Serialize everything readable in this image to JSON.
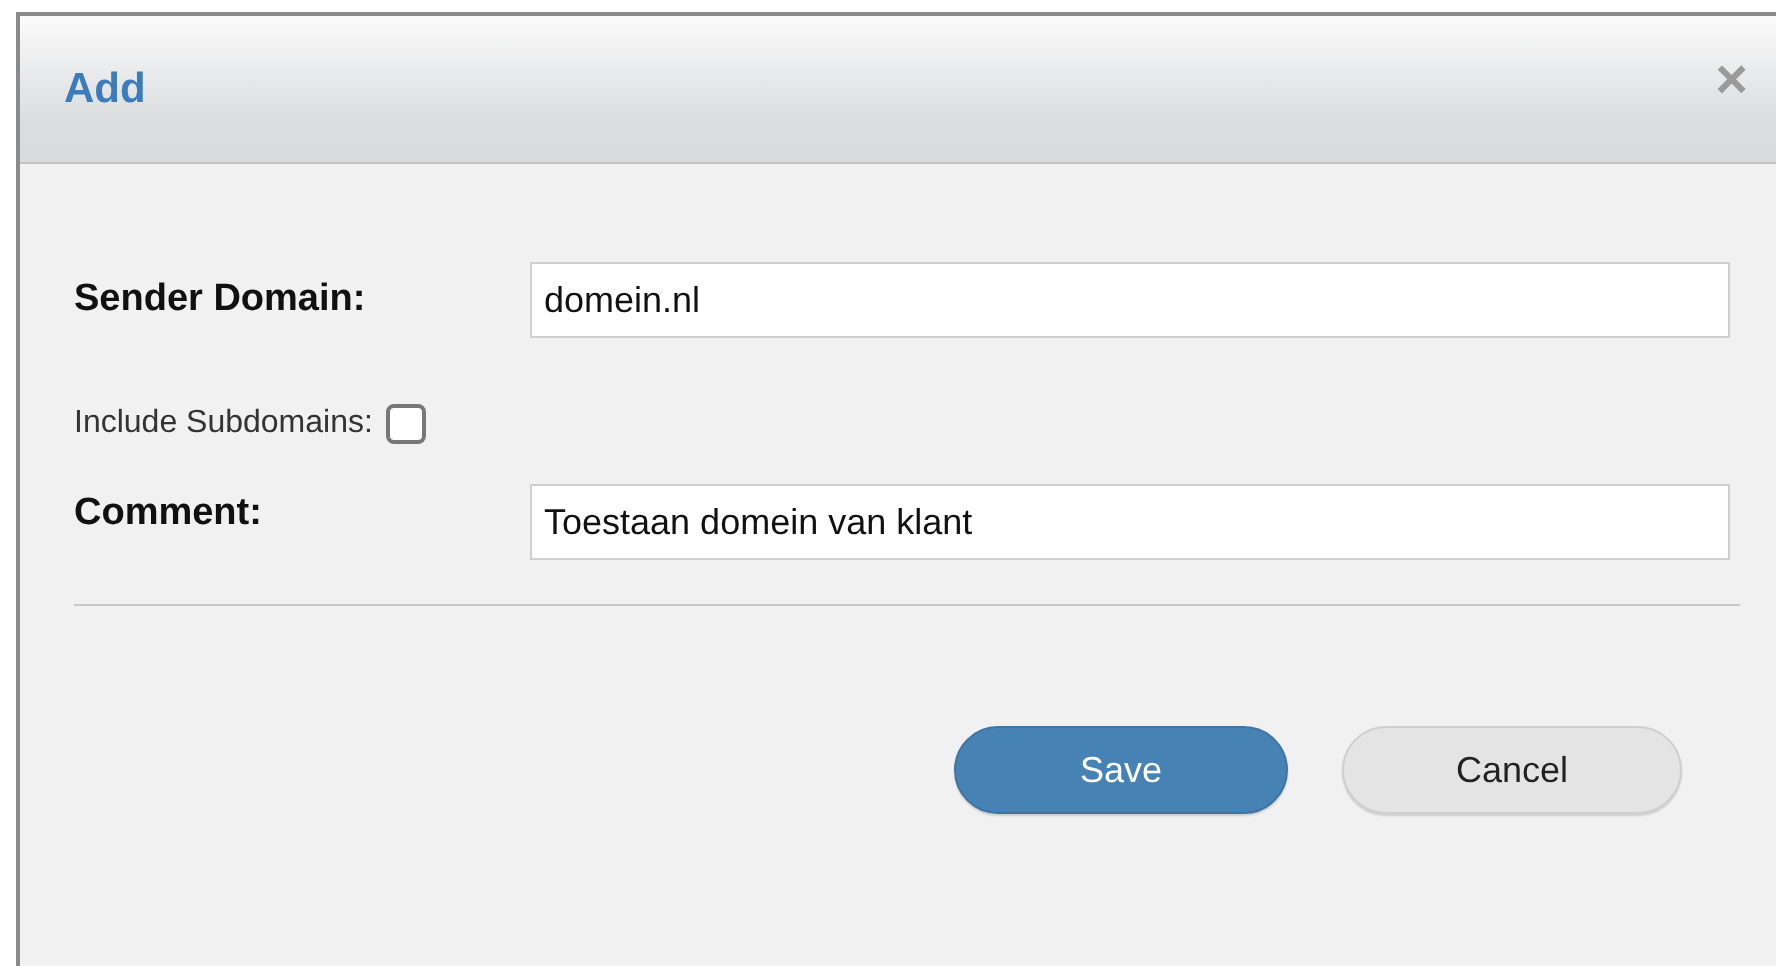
{
  "dialog": {
    "title": "Add",
    "close": "×"
  },
  "fields": [
    {
      "kind": "text",
      "label": "Sender Domain:",
      "value": "domein.nl"
    },
    {
      "kind": "checkbox",
      "label": "Include Subdomains:",
      "checked": false
    },
    {
      "kind": "text",
      "label": "Comment:",
      "value": "Toestaan domein van klant"
    }
  ],
  "buttons": [
    {
      "kind": "primary",
      "label": "Save"
    },
    {
      "kind": "secondary",
      "label": "Cancel"
    }
  ]
}
